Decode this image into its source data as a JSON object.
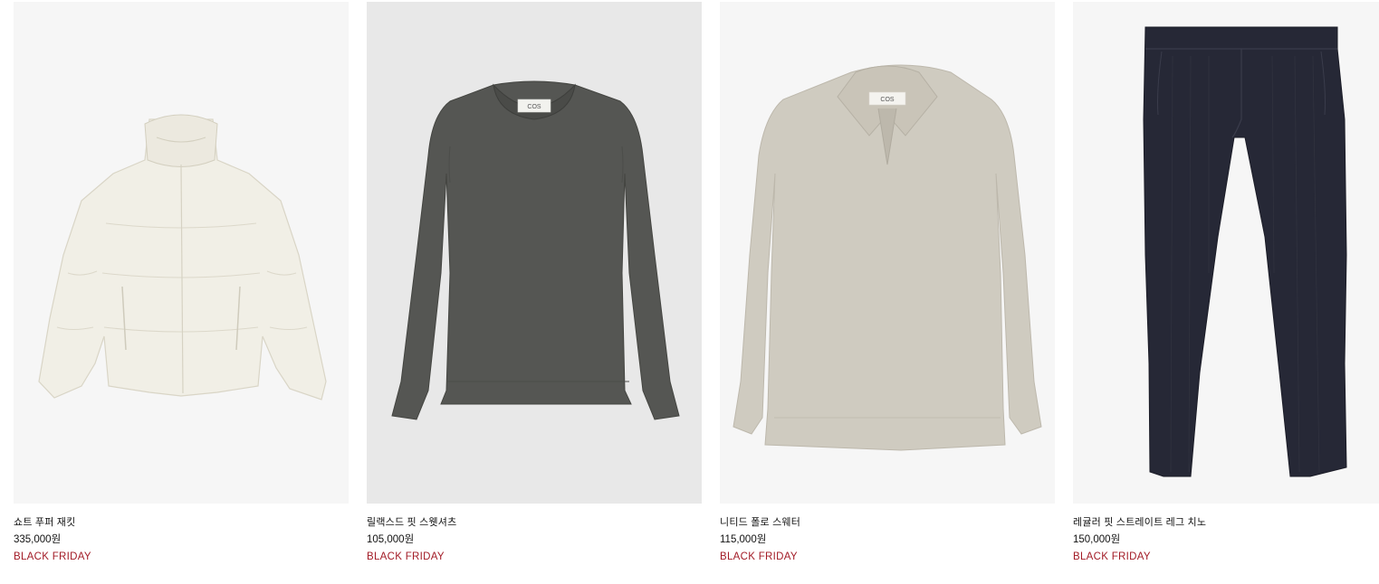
{
  "products": [
    {
      "name": "쇼트 푸퍼 재킷",
      "price": "335,000원",
      "badge": "BLACK FRIDAY",
      "image_icon": "white-puffer-jacket"
    },
    {
      "name": "릴랙스드 핏 스웻셔츠",
      "price": "105,000원",
      "badge": "BLACK FRIDAY",
      "image_icon": "charcoal-sweatshirt"
    },
    {
      "name": "니티드 폴로 스웨터",
      "price": "115,000원",
      "badge": "BLACK FRIDAY",
      "image_icon": "beige-knit-polo-sweater"
    },
    {
      "name": "레귤러 핏 스트레이트 레그 치노",
      "price": "150,000원",
      "badge": "BLACK FRIDAY",
      "image_icon": "navy-corduroy-chino"
    }
  ],
  "label_brand": "COS",
  "colors": {
    "badge": "#a21b26",
    "text": "#111111",
    "tile_light": "#f6f6f6",
    "tile_alt": "#e8e8e8"
  }
}
